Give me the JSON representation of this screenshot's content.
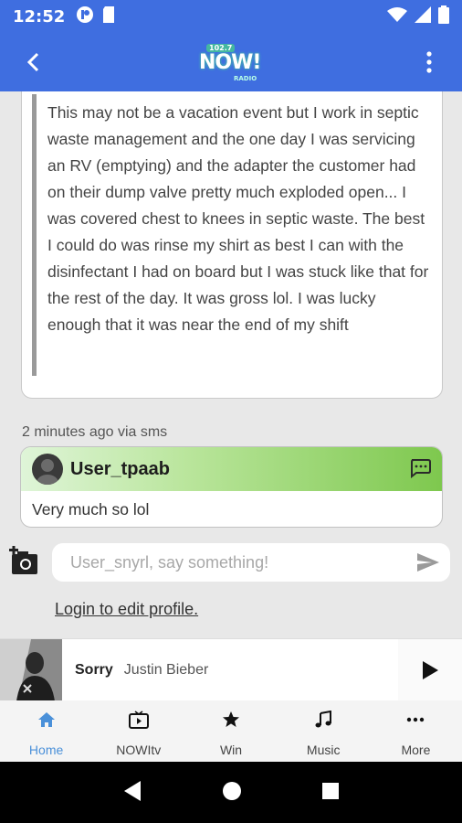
{
  "status_bar": {
    "time": "12:52",
    "icons": [
      "app-notification-icon",
      "sd-card-icon",
      "wifi-icon",
      "signal-icon",
      "battery-icon"
    ]
  },
  "app_bar": {
    "logo_frequency": "102.7",
    "logo_text": "NOW!",
    "logo_sub": "RADIO",
    "back_icon": "chevron-left-icon",
    "menu_icon": "more-vert-icon"
  },
  "quote": {
    "text": "This may not be a vacation event but I work in septic waste management and the one day I was servicing an RV (emptying) and the adapter the customer had on their dump valve pretty much exploded open... I was covered chest to knees in septic waste. The best I could do was rinse my shirt as best I can with the disinfectant I had on board but I was stuck like that for the rest of the day. It was gross lol. I was lucky enough that it was near the end of my shift"
  },
  "message": {
    "meta": "2 minutes ago via sms",
    "user": "User_tpaab",
    "body": "Very much so lol"
  },
  "composer": {
    "placeholder": "User_snyrl, say something!"
  },
  "login_link": "Login to edit profile.",
  "now_playing": {
    "title": "Sorry",
    "artist": "Justin Bieber"
  },
  "bottom_nav": {
    "items": [
      {
        "label": "Home",
        "icon": "home-icon"
      },
      {
        "label": "NOWItv",
        "icon": "tv-icon"
      },
      {
        "label": "Win",
        "icon": "star-icon"
      },
      {
        "label": "Music",
        "icon": "music-note-icon"
      },
      {
        "label": "More",
        "icon": "more-horiz-icon"
      }
    ]
  },
  "colors": {
    "primary": "#3f6ee0",
    "active_nav": "#4a90d9",
    "message_header_green": "#7ec84e"
  }
}
